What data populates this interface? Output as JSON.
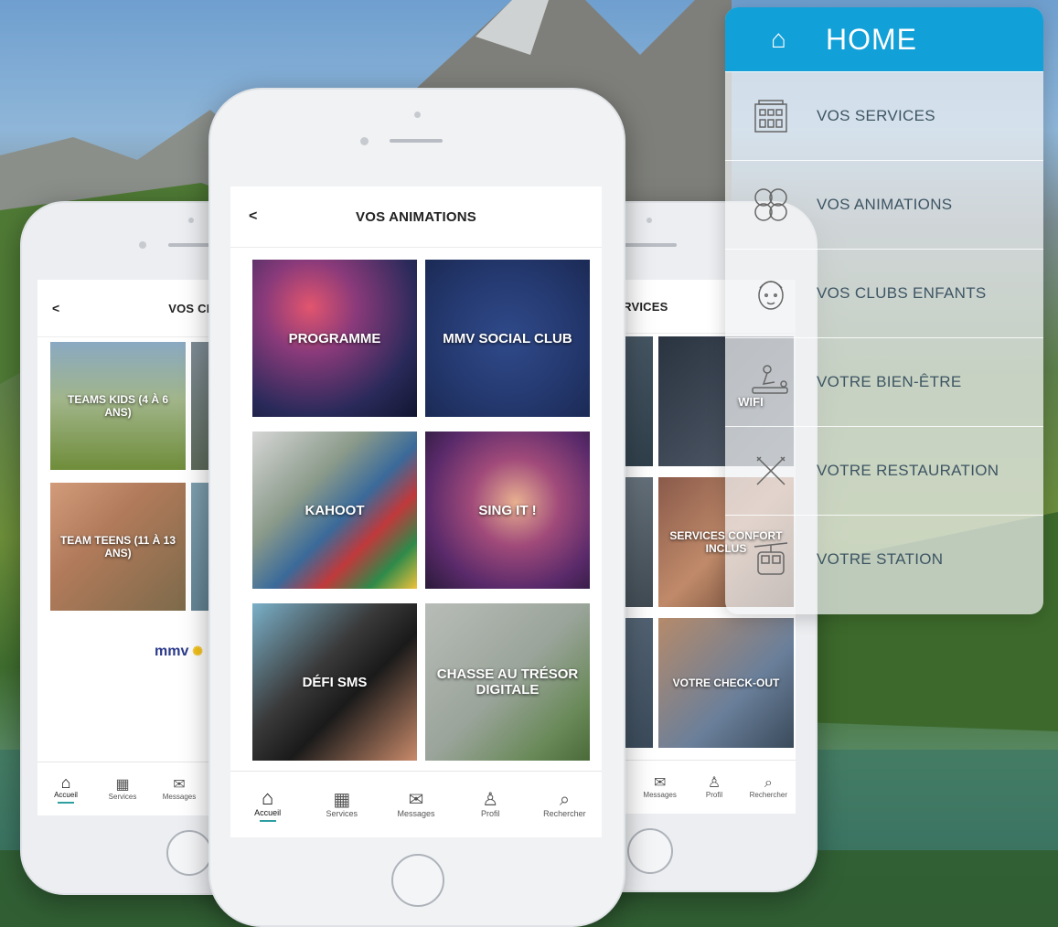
{
  "left_phone": {
    "title": "VOS CLUBS ENFANTS",
    "back": "<",
    "tiles": [
      "TEAMS KIDS (4 À 6 ANS)",
      "TEAM TEENS (11 À 13 ANS)"
    ],
    "logo": "mmv",
    "tabs": [
      "Accueil",
      "Services",
      "Messages"
    ]
  },
  "center_phone": {
    "title": "VOS ANIMATIONS",
    "back": "<",
    "tiles": [
      "PROGRAMME",
      "MMV SOCIAL CLUB",
      "KAHOOT",
      "SING IT !",
      "DÉFI SMS",
      "CHASSE AU TRÉSOR DIGITALE"
    ],
    "tabs": [
      "Accueil",
      "Services",
      "Messages",
      "Profil",
      "Rechercher"
    ],
    "active_tab": "Accueil",
    "accent": "#2e9fa0"
  },
  "right_phone": {
    "title": "VOS SERVICES",
    "tiles": [
      "WIFI",
      "SERVICES CONFORT INCLUS",
      "VOTRE CHECK-OUT"
    ],
    "tabs": [
      "Messages",
      "Profil",
      "Rechercher"
    ]
  },
  "menu": {
    "header": "HOME",
    "header_color": "#12a0d8",
    "items": [
      {
        "label": "VOS SERVICES",
        "icon": "building-icon"
      },
      {
        "label": "VOS ANIMATIONS",
        "icon": "faces-icon"
      },
      {
        "label": "VOS CLUBS ENFANTS",
        "icon": "child-face-icon"
      },
      {
        "label": "VOTRE BIEN-ÊTRE",
        "icon": "massage-icon"
      },
      {
        "label": "VOTRE RESTAURATION",
        "icon": "cutlery-icon"
      },
      {
        "label": "VOTRE STATION",
        "icon": "cable-car-icon"
      }
    ]
  }
}
